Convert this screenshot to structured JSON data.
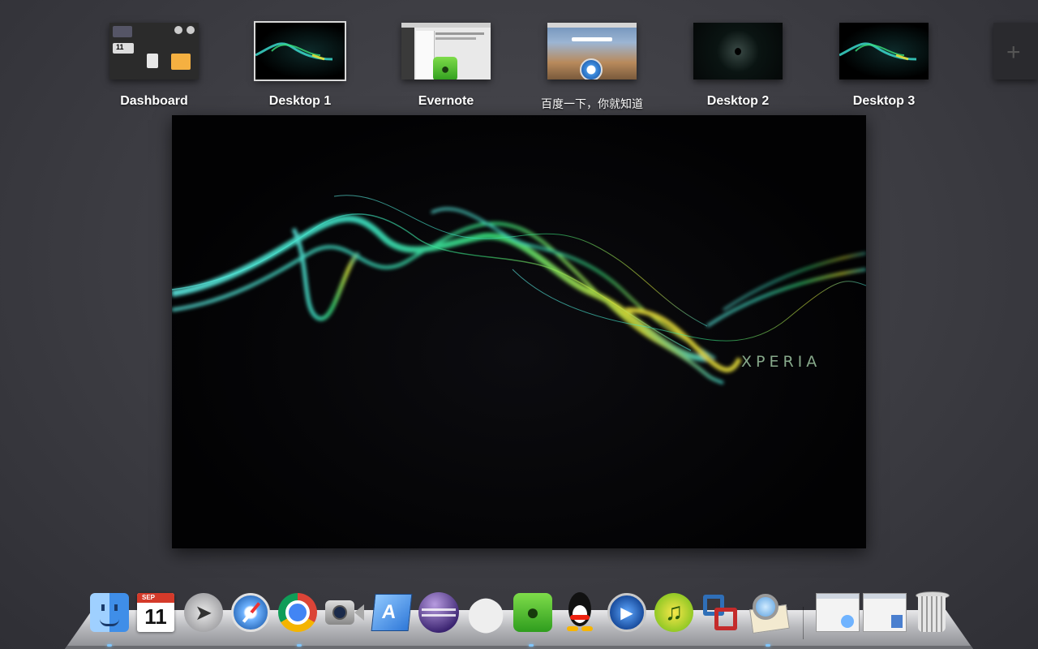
{
  "spaces": [
    {
      "label": "Dashboard"
    },
    {
      "label": "Desktop 1",
      "selected": true
    },
    {
      "label": "Evernote"
    },
    {
      "label": "百度一下，你就知道"
    },
    {
      "label": "Desktop 2"
    },
    {
      "label": "Desktop 3"
    }
  ],
  "thumb_text": {
    "date": "11"
  },
  "preview": {
    "brand": "XPERIA"
  },
  "dock": {
    "apps": [
      {
        "icon": "finder-icon"
      },
      {
        "icon": "calendar-icon",
        "month": "SEP",
        "day": "11"
      },
      {
        "icon": "launchpad-icon"
      },
      {
        "icon": "safari-icon"
      },
      {
        "icon": "chrome-icon"
      },
      {
        "icon": "facetime-icon"
      },
      {
        "icon": "xcode-icon"
      },
      {
        "icon": "eclipse-icon"
      },
      {
        "icon": "unity-icon"
      },
      {
        "icon": "evernote-icon"
      },
      {
        "icon": "qq-icon"
      },
      {
        "icon": "quicktime-icon"
      },
      {
        "icon": "music-icon"
      },
      {
        "icon": "vmware-icon"
      },
      {
        "icon": "preview-icon"
      },
      {
        "icon": "downloads-stack-icon"
      },
      {
        "icon": "documents-stack-icon"
      },
      {
        "icon": "trash-icon"
      }
    ]
  },
  "colors": {
    "accent_glow": "#7fc6ff",
    "wallpaper_teal": "#3fe6d8",
    "wallpaper_green": "#39e07a",
    "wallpaper_yellow": "#e8e03a"
  }
}
